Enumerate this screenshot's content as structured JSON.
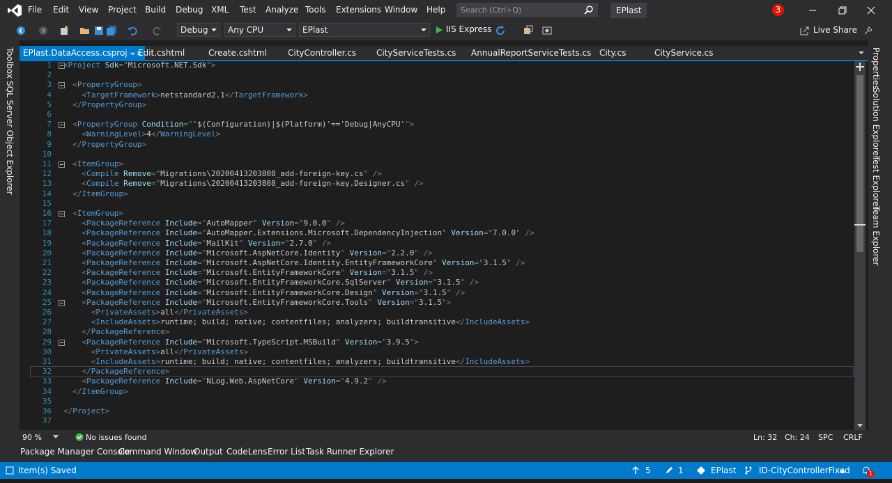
{
  "menubar": {
    "items": [
      "File",
      "Edit",
      "View",
      "Project",
      "Build",
      "Debug",
      "XML",
      "Test",
      "Analyze",
      "Tools",
      "Extensions",
      "Window",
      "Help"
    ],
    "search_placeholder": "Search (Ctrl+Q)",
    "solution_title": "EPlast",
    "notification_count": "3"
  },
  "toolbar": {
    "config": "Debug",
    "platform": "Any CPU",
    "startup_project": "EPlast",
    "run_label": "IIS Express",
    "live_share": "Live Share"
  },
  "left_panels": [
    "Toolbox",
    "SQL Server Object Explorer"
  ],
  "right_panels": [
    "Properties",
    "Solution Explorer",
    "Test Explorer",
    "Team Explorer"
  ],
  "tabs": [
    {
      "label": "EPlast.DataAccess.csproj",
      "active": true
    },
    {
      "label": "Edit.cshtml"
    },
    {
      "label": "Create.cshtml"
    },
    {
      "label": "CityController.cs"
    },
    {
      "label": "CityServiceTests.cs"
    },
    {
      "label": "AnnualReportServiceTests.cs"
    },
    {
      "label": "City.cs"
    },
    {
      "label": "CityService.cs"
    }
  ],
  "code_lines": [
    "<Project Sdk=\"Microsoft.NET.Sdk\">",
    "",
    "  <PropertyGroup>",
    "    <TargetFramework>netstandard2.1</TargetFramework>",
    "  </PropertyGroup>",
    "",
    "  <PropertyGroup Condition=\"'$(Configuration)|$(Platform)'=='Debug|AnyCPU'\">",
    "    <WarningLevel>4</WarningLevel>",
    "  </PropertyGroup>",
    "",
    "  <ItemGroup>",
    "    <Compile Remove=\"Migrations\\20200413203808_add-foreign-key.cs\" />",
    "    <Compile Remove=\"Migrations\\20200413203808_add-foreign-key.Designer.cs\" />",
    "  </ItemGroup>",
    "",
    "  <ItemGroup>",
    "    <PackageReference Include=\"AutoMapper\" Version=\"9.0.0\" />",
    "    <PackageReference Include=\"AutoMapper.Extensions.Microsoft.DependencyInjection\" Version=\"7.0.0\" />",
    "    <PackageReference Include=\"MailKit\" Version=\"2.7.0\" />",
    "    <PackageReference Include=\"Microsoft.AspNetCore.Identity\" Version=\"2.2.0\" />",
    "    <PackageReference Include=\"Microsoft.AspNetCore.Identity.EntityFrameworkCore\" Version=\"3.1.5\" />",
    "    <PackageReference Include=\"Microsoft.EntityFrameworkCore\" Version=\"3.1.5\" />",
    "    <PackageReference Include=\"Microsoft.EntityFrameworkCore.SqlServer\" Version=\"3.1.5\" />",
    "    <PackageReference Include=\"Microsoft.EntityFrameworkCore.Design\" Version=\"3.1.5\" />",
    "    <PackageReference Include=\"Microsoft.EntityFrameworkCore.Tools\" Version=\"3.1.5\">",
    "      <PrivateAssets>all</PrivateAssets>",
    "      <IncludeAssets>runtime; build; native; contentfiles; analyzers; buildtransitive</IncludeAssets>",
    "    </PackageReference>",
    "    <PackageReference Include=\"Microsoft.TypeScript.MSBuild\" Version=\"3.9.5\">",
    "      <PrivateAssets>all</PrivateAssets>",
    "      <IncludeAssets>runtime; build; native; contentfiles; analyzers; buildtransitive</IncludeAssets>",
    "    </PackageReference>",
    "    <PackageReference Include=\"NLog.Web.AspNetCore\" Version=\"4.9.2\" />",
    "  </ItemGroup>",
    "",
    "</Project>",
    ""
  ],
  "current_line": 32,
  "fold_lines": [
    1,
    3,
    7,
    11,
    16,
    25,
    29
  ],
  "editor_status": {
    "zoom": "90 %",
    "issues": "No issues found",
    "ln": "Ln: 32",
    "ch": "Ch: 24",
    "spc": "SPC",
    "crlf": "CRLF"
  },
  "bottom_tabs": [
    "Package Manager Console",
    "Command Window",
    "Output",
    "CodeLens",
    "Error List",
    "Task Runner Explorer"
  ],
  "statusbar": {
    "message": "Item(s) Saved",
    "up_count": "5",
    "edit_count": "1",
    "repo": "EPlast",
    "branch": "ID-CityControllerFixed",
    "notif_badge": "1"
  },
  "colors": {
    "accent": "#007acc",
    "bg": "#1e1e1e",
    "chrome": "#2d2d30"
  }
}
